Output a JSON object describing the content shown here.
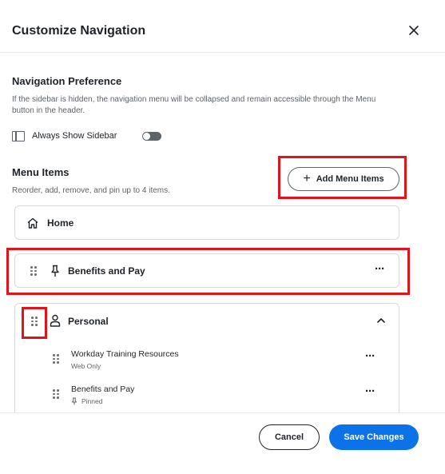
{
  "dialog": {
    "title": "Customize Navigation",
    "close_icon": "close-icon"
  },
  "navigation_preference": {
    "title": "Navigation Preference",
    "description": "If the sidebar is hidden, the navigation menu will be collapsed and remain accessible through the Menu button in the header.",
    "always_show_sidebar": {
      "label": "Always Show Sidebar",
      "icon": "sidebar-panel-icon",
      "enabled": false
    }
  },
  "menu_items": {
    "title": "Menu Items",
    "description": "Reorder, add, remove, and pin up to 4 items.",
    "add_button_label": "Add Menu Items",
    "home": {
      "label": "Home",
      "icon": "home-icon"
    },
    "pinned": {
      "label": "Benefits and Pay",
      "icon": "pin-icon"
    },
    "personal": {
      "label": "Personal",
      "icon": "person-icon",
      "expanded": true,
      "children": [
        {
          "label": "Workday Training Resources",
          "meta": "Web Only"
        },
        {
          "label": "Benefits and Pay",
          "meta": "Pinned",
          "meta_icon": "pin-icon"
        }
      ]
    }
  },
  "footer": {
    "cancel_label": "Cancel",
    "save_label": "Save Changes"
  },
  "colors": {
    "accent": "#0b72e7",
    "highlight_annotation": "#e0151c",
    "text": "#1f2328",
    "muted": "#5e6368"
  }
}
